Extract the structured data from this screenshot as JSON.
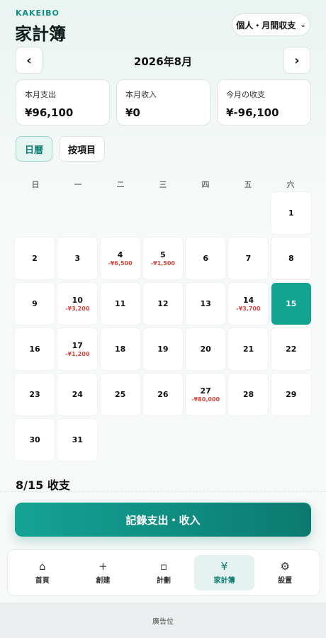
{
  "header": {
    "brand": "KAKEIBO",
    "title": "家計簿",
    "mode_select": {
      "value": "個人・月間収支",
      "icon": "chevron-down-icon"
    }
  },
  "month_nav": {
    "prev_label": "‹",
    "next_label": "›",
    "month": "2026年8月"
  },
  "stats": [
    {
      "label": "本月支出",
      "value": "¥96,100"
    },
    {
      "label": "本月收入",
      "value": "¥0"
    },
    {
      "label": "今月の收支",
      "value": "¥-96,100"
    }
  ],
  "view_tabs": [
    {
      "label": "日曆",
      "active": true
    },
    {
      "label": "按項目",
      "active": false
    }
  ],
  "weekdays": [
    "日",
    "一",
    "二",
    "三",
    "四",
    "五",
    "六"
  ],
  "calendar": {
    "leading_blanks": 6,
    "today": 15,
    "days": [
      {
        "d": "1",
        "amt": ""
      },
      {
        "d": "2",
        "amt": ""
      },
      {
        "d": "3",
        "amt": ""
      },
      {
        "d": "4",
        "amt": "-¥6,500"
      },
      {
        "d": "5",
        "amt": "-¥1,500"
      },
      {
        "d": "6",
        "amt": ""
      },
      {
        "d": "7",
        "amt": ""
      },
      {
        "d": "8",
        "amt": ""
      },
      {
        "d": "9",
        "amt": ""
      },
      {
        "d": "10",
        "amt": "-¥3,200"
      },
      {
        "d": "11",
        "amt": ""
      },
      {
        "d": "12",
        "amt": ""
      },
      {
        "d": "13",
        "amt": ""
      },
      {
        "d": "14",
        "amt": "-¥3,700"
      },
      {
        "d": "15",
        "amt": ""
      },
      {
        "d": "16",
        "amt": ""
      },
      {
        "d": "17",
        "amt": "-¥1,200"
      },
      {
        "d": "18",
        "amt": ""
      },
      {
        "d": "19",
        "amt": ""
      },
      {
        "d": "20",
        "amt": ""
      },
      {
        "d": "21",
        "amt": ""
      },
      {
        "d": "22",
        "amt": ""
      },
      {
        "d": "23",
        "amt": ""
      },
      {
        "d": "24",
        "amt": ""
      },
      {
        "d": "25",
        "amt": ""
      },
      {
        "d": "26",
        "amt": ""
      },
      {
        "d": "27",
        "amt": "-¥80,000"
      },
      {
        "d": "28",
        "amt": ""
      },
      {
        "d": "29",
        "amt": ""
      },
      {
        "d": "30",
        "amt": ""
      },
      {
        "d": "31",
        "amt": ""
      }
    ]
  },
  "section_title": "8/15 收支",
  "record_button": "記錄支出・收入",
  "tabbar": [
    {
      "icon": "home-icon",
      "glyph": "⌂",
      "label": "首頁",
      "active": false
    },
    {
      "icon": "plus-icon",
      "glyph": "+",
      "label": "創建",
      "active": false
    },
    {
      "icon": "square-icon",
      "glyph": "▫",
      "label": "計劃",
      "active": false
    },
    {
      "icon": "yen-icon",
      "glyph": "¥",
      "label": "家計簿",
      "active": true
    },
    {
      "icon": "gear-icon",
      "glyph": "⚙",
      "label": "設置",
      "active": false
    }
  ],
  "ad_label": "廣告位",
  "colors": {
    "accent": "#12a391",
    "expense": "#d2473e"
  }
}
